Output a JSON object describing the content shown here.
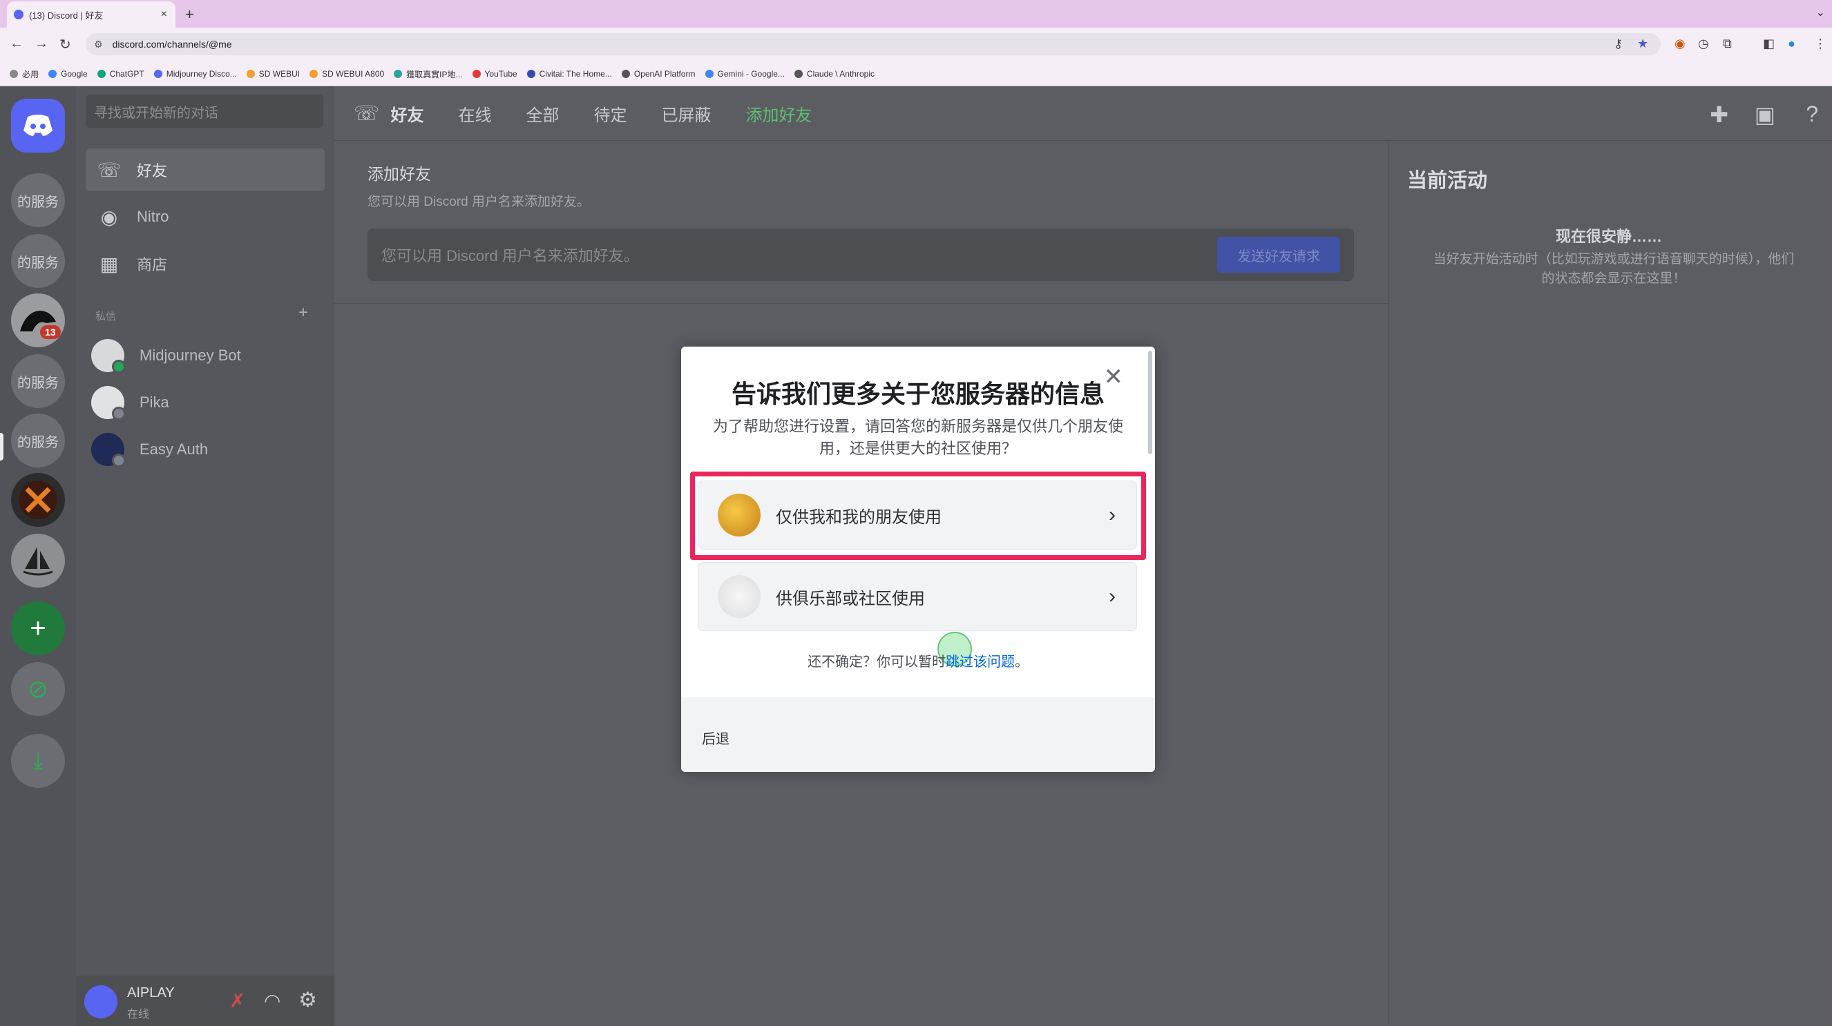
{
  "browser": {
    "tab_title": "(13) Discord | 好友",
    "url": "discord.com/channels/@me",
    "bookmarks": [
      "必用",
      "Google",
      "ChatGPT",
      "Midjourney Disco...",
      "SD WEBUI",
      "SD WEBUI A800",
      "獲取真實IP地...",
      "YouTube",
      "Civitai: The Home...",
      "OpenAI Platform",
      "Gemini - Google...",
      "Claude \\ Anthropic"
    ]
  },
  "guilds": {
    "items": [
      "的服务",
      "的服务",
      "的服务",
      "的服务"
    ],
    "badge": "13"
  },
  "channels": {
    "search_placeholder": "寻找或开始新的对话",
    "nav": [
      {
        "label": "好友"
      },
      {
        "label": "Nitro"
      },
      {
        "label": "商店"
      }
    ],
    "dm_header": "私信",
    "dms": [
      {
        "name": "Midjourney Bot"
      },
      {
        "name": "Pika"
      },
      {
        "name": "Easy Auth"
      }
    ],
    "user": {
      "name": "AIPLAY",
      "status": "在线"
    }
  },
  "topbar": {
    "friends": "好友",
    "tabs": [
      "在线",
      "全部",
      "待定",
      "已屏蔽"
    ],
    "add_friend": "添加好友"
  },
  "add_friend": {
    "title": "添加好友",
    "subtitle": "您可以用 Discord 用户名来添加好友。",
    "input_placeholder": "您可以用 Discord 用户名来添加好友。",
    "send_button": "发送好友请求"
  },
  "activity": {
    "title": "当前活动",
    "quiet": "现在很安静……",
    "desc": "当好友开始活动时（比如玩游戏或进行语音聊天的时候），他们的状态都会显示在这里！"
  },
  "modal": {
    "title": "告诉我们更多关于您服务器的信息",
    "desc": "为了帮助您进行设置，请回答您的新服务器是仅供几个朋友使用，还是供更大的社区使用？",
    "options": [
      {
        "label": "仅供我和我的朋友使用"
      },
      {
        "label": "供俱乐部或社区使用"
      }
    ],
    "unsure_prefix": "还不确定？你可以暂时",
    "unsure_link": "跳过该问题",
    "unsure_suffix": "。",
    "back": "后退"
  },
  "colors": {
    "highlight": "#e8275f",
    "add_friend_green": "#5dbf6e",
    "blurple": "#5865f2"
  }
}
